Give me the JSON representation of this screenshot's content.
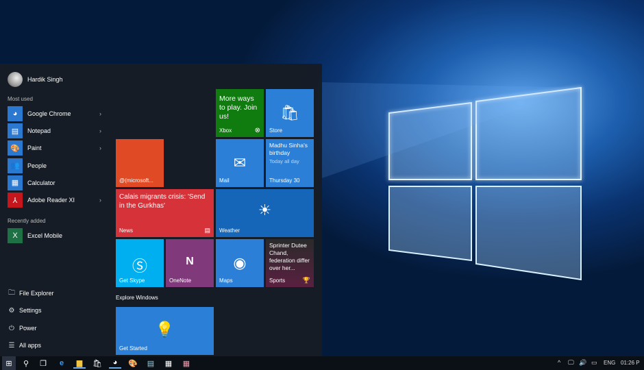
{
  "user": {
    "name": "Hardik Singh"
  },
  "most_used": {
    "label": "Most used",
    "items": [
      {
        "label": "Google Chrome",
        "icon": "chrome-icon",
        "arrow": true
      },
      {
        "label": "Notepad",
        "icon": "notepad-icon",
        "arrow": true
      },
      {
        "label": "Paint",
        "icon": "paint-icon",
        "arrow": true
      },
      {
        "label": "People",
        "icon": "people-icon",
        "arrow": false
      },
      {
        "label": "Calculator",
        "icon": "calculator-icon",
        "arrow": false
      },
      {
        "label": "Adobe Reader XI",
        "icon": "adobe-reader-icon",
        "arrow": true
      }
    ]
  },
  "recently_added": {
    "label": "Recently added",
    "items": [
      {
        "label": "Excel Mobile",
        "icon": "excel-icon"
      }
    ]
  },
  "bottom": {
    "file_explorer": "File Explorer",
    "settings": "Settings",
    "power": "Power",
    "all_apps": "All apps"
  },
  "tiles": {
    "xbox": {
      "text": "More ways to play. Join us!",
      "name": "Xbox",
      "color": "#107c10"
    },
    "store": {
      "name": "Store",
      "color": "#2b7fd6"
    },
    "twitter": {
      "name": "@(microsoft...",
      "color": "#e04a24"
    },
    "mail": {
      "name": "Mail",
      "color": "#2b7fd6"
    },
    "calendar": {
      "title": "Madhu Sinha's birthday",
      "sub": "Today all day",
      "name": "Thursday 30",
      "color": "#2b7fd6"
    },
    "news": {
      "text": "Calais migrants crisis: 'Send in the Gurkhas'",
      "name": "News",
      "color": "#d6323a"
    },
    "weather": {
      "name": "Weather",
      "color": "#1565b8"
    },
    "skype": {
      "name": "Get Skype",
      "color": "#00aff0"
    },
    "onenote": {
      "name": "OneNote",
      "color": "#80397b"
    },
    "maps": {
      "name": "Maps",
      "color": "#2b7fd6"
    },
    "sports": {
      "text": "Sprinter Dutee Chand, federation differ over her...",
      "name": "Sports"
    },
    "explore_label": "Explore Windows",
    "get_started": {
      "name": "Get Started",
      "color": "#2b7fd6"
    }
  },
  "taskbar": {
    "tray": {
      "language": "ENG",
      "time": "01:26 P"
    }
  }
}
